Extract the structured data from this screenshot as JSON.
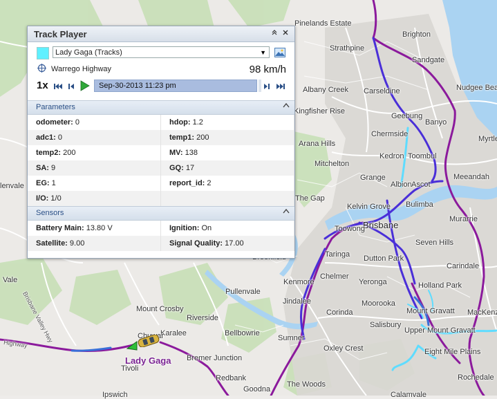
{
  "panel": {
    "title": "Track Player",
    "track_select": "Lady Gaga (Tracks)",
    "track_color": "#5ff0ff",
    "location": "Warrego Highway",
    "speed": "98 km/h",
    "playback_rate": "1x",
    "current_time": "Sep-30-2013 11:23 pm",
    "icons": [
      "collapse-up-icon",
      "close-icon",
      "dropdown-arrow-icon",
      "image-icon",
      "crosshair-icon",
      "skip-start-icon",
      "step-back-icon",
      "play-icon",
      "step-forward-icon",
      "skip-end-icon"
    ]
  },
  "parameters": {
    "title": "Parameters",
    "rows": [
      [
        {
          "k": "odometer:",
          "v": "0"
        },
        {
          "k": "hdop:",
          "v": "1.2"
        }
      ],
      [
        {
          "k": "adc1:",
          "v": "0"
        },
        {
          "k": "temp1:",
          "v": "200"
        }
      ],
      [
        {
          "k": "temp2:",
          "v": "200"
        },
        {
          "k": "MV:",
          "v": "138"
        }
      ],
      [
        {
          "k": "SA:",
          "v": "9"
        },
        {
          "k": "GQ:",
          "v": "17"
        }
      ],
      [
        {
          "k": "EG:",
          "v": "1"
        },
        {
          "k": "report_id:",
          "v": "2"
        }
      ],
      [
        {
          "k": "I/O:",
          "v": "1/0"
        },
        {
          "k": "",
          "v": ""
        }
      ]
    ]
  },
  "sensors": {
    "title": "Sensors",
    "rows": [
      [
        {
          "k": "Battery Main:",
          "v": "13.80 V"
        },
        {
          "k": "Ignition:",
          "v": "On"
        }
      ],
      [
        {
          "k": "Satellite:",
          "v": "9.00"
        },
        {
          "k": "Signal Quality:",
          "v": "17.00"
        }
      ]
    ]
  },
  "map": {
    "vehicle_label": "Lady Gaga",
    "places": [
      "Pinelands Estate",
      "Brighton",
      "Strathpine",
      "Sandgate",
      "Albany Creek",
      "Carseldine",
      "Nudgee Beach",
      "Geebung",
      "Banyo",
      "Kingfisher Rise",
      "Chermside",
      "Myrtle",
      "Arana Hills",
      "Kedron",
      "Toombul",
      "Mitchelton",
      "Meeandah",
      "Grange",
      "Albion",
      "Ascot",
      "The Gap",
      "Kelvin Grove",
      "Bulimba",
      "Brisbane",
      "Murarrie",
      "Toowong",
      "Seven Hills",
      "Taringa",
      "Dutton Park",
      "Carindale",
      "Brookfield",
      "Kenmore",
      "Chelmer",
      "Yeronga",
      "Holland Park",
      "Vale",
      "Pullenvale",
      "Jindalee",
      "Moorooka",
      "Mount Gravatt",
      "MacKenzie",
      "Mount Crosby",
      "Corinda",
      "Salisbury",
      "Riverside",
      "Karalee",
      "Chuwar",
      "Bellbowrie",
      "Sumner",
      "Upper Mount Gravatt",
      "Bremer Junction",
      "Oxley Crest",
      "Eight Mile Plains",
      "Tivoli",
      "Redbank",
      "The Woods",
      "Goodna",
      "Rochedale",
      "Ipswich",
      "Calamvale",
      "lenvale"
    ],
    "roads": [
      "Brisbane Valley Hwy",
      "Highway"
    ],
    "route_colors": {
      "highway": "#8b1a9c",
      "city": "#4a2fd8",
      "bright": "#5fdcff",
      "blue": "#3a6fd8"
    }
  }
}
